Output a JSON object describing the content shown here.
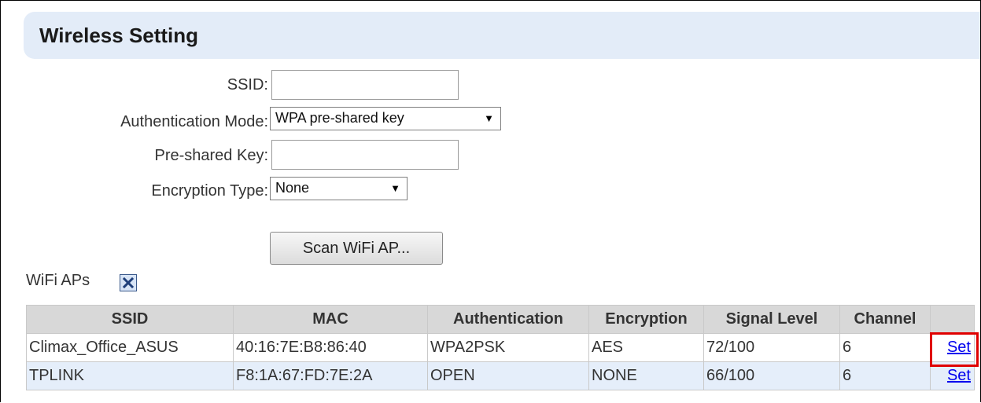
{
  "header": {
    "title": "Wireless Setting"
  },
  "form": {
    "ssid": {
      "label": "SSID:",
      "value": ""
    },
    "auth_mode": {
      "label": "Authentication Mode:",
      "selected": "WPA pre-shared key"
    },
    "psk": {
      "label": "Pre-shared Key:",
      "value": ""
    },
    "encryption": {
      "label": "Encryption Type:",
      "selected": "None"
    }
  },
  "scan_button": {
    "label": "Scan WiFi AP..."
  },
  "wifi_aps": {
    "label": "WiFi APs",
    "close_icon": "close-x-icon"
  },
  "table": {
    "headers": [
      "SSID",
      "MAC",
      "Authentication",
      "Encryption",
      "Signal Level",
      "Channel",
      ""
    ],
    "rows": [
      {
        "ssid": "Climax_Office_ASUS",
        "mac": "40:16:7E:B8:86:40",
        "auth": "WPA2PSK",
        "enc": "AES",
        "signal": "72/100",
        "channel": "6",
        "action": "Set"
      },
      {
        "ssid": "TPLINK",
        "mac": "F8:1A:67:FD:7E:2A",
        "auth": "OPEN",
        "enc": "NONE",
        "signal": "66/100",
        "channel": "6",
        "action": "Set"
      }
    ]
  },
  "colors": {
    "header_bg": "#e3ecf8",
    "highlight": "#e00000",
    "link": "#0000ee",
    "alt_row": "#e5eefa"
  }
}
